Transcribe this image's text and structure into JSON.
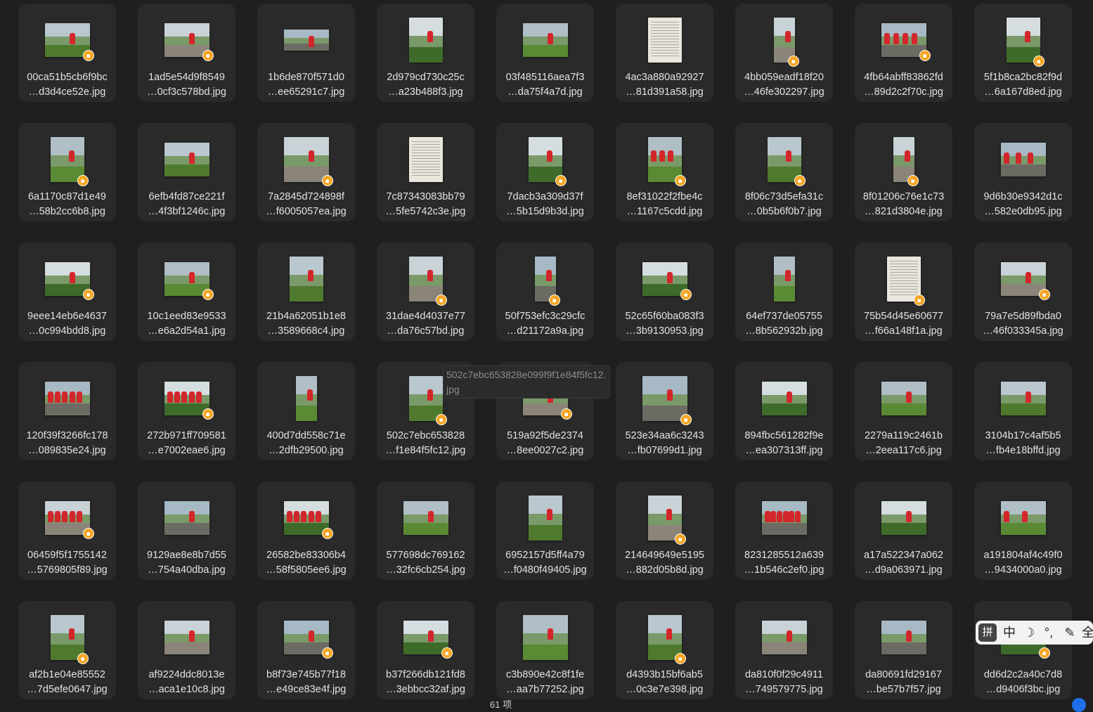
{
  "files": [
    {
      "line1": "00ca51b5cb6f9bc",
      "line2": "…d3d4ce52e.jpg",
      "kind": "photo",
      "w": 64,
      "h": 48,
      "people": 1,
      "lock": true
    },
    {
      "line1": "1ad5e54d9f8549",
      "line2": "…0cf3c578bd.jpg",
      "kind": "photo",
      "w": 64,
      "h": 48,
      "people": 1,
      "lock": true
    },
    {
      "line1": "1b6de870f571d0",
      "line2": "…ee65291c7.jpg",
      "kind": "photo",
      "w": 64,
      "h": 30,
      "people": 1,
      "lock": false
    },
    {
      "line1": "2d979cd730c25c",
      "line2": "…a23b488f3.jpg",
      "kind": "photo",
      "w": 48,
      "h": 64,
      "people": 1,
      "lock": false
    },
    {
      "line1": "03f485116aea7f3",
      "line2": "…da75f4a7d.jpg",
      "kind": "photo",
      "w": 64,
      "h": 48,
      "people": 1,
      "lock": false
    },
    {
      "line1": "4ac3a880a92927",
      "line2": "…81d391a58.jpg",
      "kind": "doc",
      "w": 48,
      "h": 64,
      "people": 0,
      "lock": false
    },
    {
      "line1": "4bb059eadf18f20",
      "line2": "…46fe302297.jpg",
      "kind": "photo",
      "w": 30,
      "h": 64,
      "people": 1,
      "lock": true
    },
    {
      "line1": "4fb64abff83862fd",
      "line2": "…89d2c2f70c.jpg",
      "kind": "photo",
      "w": 64,
      "h": 48,
      "people": 4,
      "lock": true
    },
    {
      "line1": "5f1b8ca2bc82f9d",
      "line2": "…6a167d8ed.jpg",
      "kind": "photo",
      "w": 48,
      "h": 64,
      "people": 1,
      "lock": true
    },
    {
      "line1": "6a1170c87d1e49",
      "line2": "…58b2cc6b8.jpg",
      "kind": "photo",
      "w": 48,
      "h": 64,
      "people": 1,
      "lock": true
    },
    {
      "line1": "6efb4fd87ce221f",
      "line2": "…4f3bf1246c.jpg",
      "kind": "photo",
      "w": 64,
      "h": 48,
      "people": 1,
      "lock": false
    },
    {
      "line1": "7a2845d724898f",
      "line2": "…f6005057ea.jpg",
      "kind": "photo",
      "w": 64,
      "h": 64,
      "people": 1,
      "lock": true
    },
    {
      "line1": "7c87343083bb79",
      "line2": "…5fe5742c3e.jpg",
      "kind": "doc",
      "w": 48,
      "h": 64,
      "people": 0,
      "lock": false
    },
    {
      "line1": "7dacb3a309d37f",
      "line2": "…5b15d9b3d.jpg",
      "kind": "photo",
      "w": 48,
      "h": 64,
      "people": 1,
      "lock": true
    },
    {
      "line1": "8ef31022f2fbe4c",
      "line2": "…1167c5cdd.jpg",
      "kind": "photo",
      "w": 48,
      "h": 64,
      "people": 3,
      "lock": true
    },
    {
      "line1": "8f06c73d5efa31c",
      "line2": "…0b5b6f0b7.jpg",
      "kind": "photo",
      "w": 48,
      "h": 64,
      "people": 1,
      "lock": true
    },
    {
      "line1": "8f01206c76e1c73",
      "line2": "…821d3804e.jpg",
      "kind": "photo",
      "w": 30,
      "h": 64,
      "people": 1,
      "lock": true
    },
    {
      "line1": "9d6b30e9342d1c",
      "line2": "…582e0db95.jpg",
      "kind": "photo",
      "w": 64,
      "h": 48,
      "people": 3,
      "lock": false
    },
    {
      "line1": "9eee14eb6e4637",
      "line2": "…0c994bdd8.jpg",
      "kind": "photo",
      "w": 64,
      "h": 48,
      "people": 1,
      "lock": true
    },
    {
      "line1": "10c1eed83e9533",
      "line2": "…e6a2d54a1.jpg",
      "kind": "photo",
      "w": 64,
      "h": 48,
      "people": 1,
      "lock": true
    },
    {
      "line1": "21b4a62051b1e8",
      "line2": "…3589668c4.jpg",
      "kind": "photo",
      "w": 48,
      "h": 64,
      "people": 1,
      "lock": false
    },
    {
      "line1": "31dae4d4037e77",
      "line2": "…da76c57bd.jpg",
      "kind": "photo",
      "w": 48,
      "h": 64,
      "people": 1,
      "lock": true
    },
    {
      "line1": "50f753efc3c29cfc",
      "line2": "…d21172a9a.jpg",
      "kind": "photo",
      "w": 30,
      "h": 64,
      "people": 1,
      "lock": true
    },
    {
      "line1": "52c65f60ba083f3",
      "line2": "…3b9130953.jpg",
      "kind": "photo",
      "w": 64,
      "h": 48,
      "people": 1,
      "lock": true
    },
    {
      "line1": "64ef737de05755",
      "line2": "…8b562932b.jpg",
      "kind": "photo",
      "w": 30,
      "h": 64,
      "people": 1,
      "lock": false
    },
    {
      "line1": "75b54d45e60677",
      "line2": "…f66a148f1a.jpg",
      "kind": "doc",
      "w": 48,
      "h": 64,
      "people": 0,
      "lock": true
    },
    {
      "line1": "79a7e5d89fbda0",
      "line2": "…46f033345a.jpg",
      "kind": "photo",
      "w": 64,
      "h": 48,
      "people": 1,
      "lock": true
    },
    {
      "line1": "120f39f3266fc178",
      "line2": "…089835e24.jpg",
      "kind": "photo",
      "w": 64,
      "h": 48,
      "people": 5,
      "lock": false
    },
    {
      "line1": "272b971ff709581",
      "line2": "…e7002eae6.jpg",
      "kind": "photo",
      "w": 64,
      "h": 48,
      "people": 5,
      "lock": true
    },
    {
      "line1": "400d7dd558c71e",
      "line2": "…2dfb29500.jpg",
      "kind": "photo",
      "w": 30,
      "h": 64,
      "people": 1,
      "lock": false
    },
    {
      "line1": "502c7ebc653828",
      "line2": "…f1e84f5fc12.jpg",
      "kind": "photo",
      "w": 48,
      "h": 64,
      "people": 1,
      "lock": true
    },
    {
      "line1": "519a92f5de2374",
      "line2": "…8ee0027c2.jpg",
      "kind": "photo",
      "w": 64,
      "h": 48,
      "people": 1,
      "lock": true
    },
    {
      "line1": "523e34aa6c3243",
      "line2": "…fb07699d1.jpg",
      "kind": "photo",
      "w": 64,
      "h": 64,
      "people": 1,
      "lock": true
    },
    {
      "line1": "894fbc561282f9e",
      "line2": "…ea307313ff.jpg",
      "kind": "photo",
      "w": 64,
      "h": 48,
      "people": 1,
      "lock": false
    },
    {
      "line1": "2279a119c2461b",
      "line2": "…2eea117c6.jpg",
      "kind": "photo",
      "w": 64,
      "h": 48,
      "people": 1,
      "lock": false
    },
    {
      "line1": "3104b17c4af5b5",
      "line2": "…fb4e18bffd.jpg",
      "kind": "photo",
      "w": 64,
      "h": 48,
      "people": 1,
      "lock": false
    },
    {
      "line1": "06459f5f1755142",
      "line2": "…5769805f89.jpg",
      "kind": "photo",
      "w": 64,
      "h": 48,
      "people": 5,
      "lock": true
    },
    {
      "line1": "9129ae8e8b7d55",
      "line2": "…754a40dba.jpg",
      "kind": "photo",
      "w": 64,
      "h": 48,
      "people": 1,
      "lock": false
    },
    {
      "line1": "26582be83306b4",
      "line2": "…58f5805ee6.jpg",
      "kind": "photo",
      "w": 64,
      "h": 48,
      "people": 5,
      "lock": true
    },
    {
      "line1": "577698dc769162",
      "line2": "…32fc6cb254.jpg",
      "kind": "photo",
      "w": 64,
      "h": 48,
      "people": 1,
      "lock": false
    },
    {
      "line1": "6952157d5ff4a79",
      "line2": "…f0480f49405.jpg",
      "kind": "photo",
      "w": 48,
      "h": 64,
      "people": 1,
      "lock": false
    },
    {
      "line1": "214649649e5195",
      "line2": "…882d05b8d.jpg",
      "kind": "photo",
      "w": 48,
      "h": 64,
      "people": 1,
      "lock": true
    },
    {
      "line1": "8231285512a639",
      "line2": "…1b546c2ef0.jpg",
      "kind": "photo",
      "w": 64,
      "h": 48,
      "people": 6,
      "lock": false
    },
    {
      "line1": "a17a522347a062",
      "line2": "…d9a063971.jpg",
      "kind": "photo",
      "w": 64,
      "h": 48,
      "people": 1,
      "lock": false
    },
    {
      "line1": "a191804af4c49f0",
      "line2": "…9434000a0.jpg",
      "kind": "photo",
      "w": 64,
      "h": 48,
      "people": 2,
      "lock": false
    },
    {
      "line1": "af2b1e04e85552",
      "line2": "…7d5efe0647.jpg",
      "kind": "photo",
      "w": 48,
      "h": 64,
      "people": 1,
      "lock": true
    },
    {
      "line1": "af9224ddc8013e",
      "line2": "…aca1e10c8.jpg",
      "kind": "photo",
      "w": 64,
      "h": 48,
      "people": 1,
      "lock": false
    },
    {
      "line1": "b8f73e745b77f18",
      "line2": "…e49ce83e4f.jpg",
      "kind": "photo",
      "w": 64,
      "h": 48,
      "people": 1,
      "lock": true
    },
    {
      "line1": "b37f266db121fd8",
      "line2": "…3ebbcc32af.jpg",
      "kind": "photo",
      "w": 64,
      "h": 48,
      "people": 1,
      "lock": true
    },
    {
      "line1": "c3b890e42c8f1fe",
      "line2": "…aa7b77252.jpg",
      "kind": "photo",
      "w": 64,
      "h": 64,
      "people": 1,
      "lock": false
    },
    {
      "line1": "d4393b15bf6ab5",
      "line2": "…0c3e7e398.jpg",
      "kind": "photo",
      "w": 48,
      "h": 64,
      "people": 1,
      "lock": true
    },
    {
      "line1": "da810f0f29c4911",
      "line2": "…749579775.jpg",
      "kind": "photo",
      "w": 64,
      "h": 48,
      "people": 1,
      "lock": false
    },
    {
      "line1": "da80691fd29167",
      "line2": "…be57b7f57.jpg",
      "kind": "photo",
      "w": 64,
      "h": 48,
      "people": 1,
      "lock": false
    },
    {
      "line1": "dd6d2c2a40c7d8",
      "line2": "…d9406f3bc.jpg",
      "kind": "photo",
      "w": 64,
      "h": 48,
      "people": 1,
      "lock": true
    }
  ],
  "tooltip": "502c7ebc653828e099f9f1e84f5fc12.jpg",
  "item_count": "61 项",
  "lock_icon": "lock-icon",
  "colors": {
    "background": "#1f1f1f",
    "tile": "#2a2a2a",
    "lock": "#f5a623",
    "vest": "#d3262b"
  },
  "ime_toolbar": {
    "keyboard": "拼",
    "mode": "中",
    "moon": "☽",
    "punct": "°,",
    "pen": "✎",
    "more": "全"
  }
}
